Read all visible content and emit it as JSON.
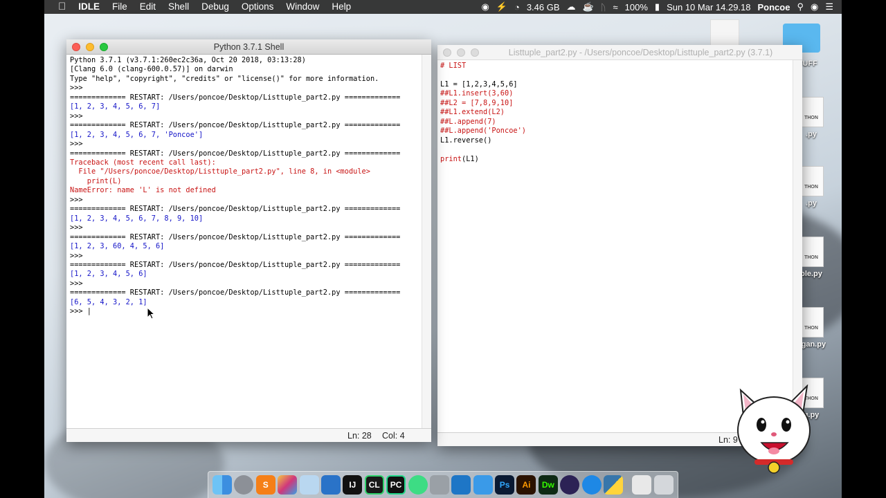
{
  "menubar": {
    "app": "IDLE",
    "items": [
      "File",
      "Edit",
      "Shell",
      "Debug",
      "Options",
      "Window",
      "Help"
    ],
    "memory": "3.46 GB",
    "battery": "100%",
    "datetime": "Sun 10 Mar  14.29.18",
    "user": "Poncoe"
  },
  "shell": {
    "title": "Python 3.7.1 Shell",
    "lines": [
      {
        "t": "Python 3.7.1 (v3.7.1:260ec2c36a, Oct 20 2018, 03:13:28)",
        "c": "blk"
      },
      {
        "t": "[Clang 6.0 (clang-600.0.57)] on darwin",
        "c": "blk"
      },
      {
        "t": "Type \"help\", \"copyright\", \"credits\" or \"license()\" for more information.",
        "c": "blk"
      },
      {
        "t": ">>>",
        "c": "blk"
      },
      {
        "t": "============= RESTART: /Users/poncoe/Desktop/Listtuple_part2.py =============",
        "c": "blk"
      },
      {
        "t": "[1, 2, 3, 4, 5, 6, 7]",
        "c": "blue"
      },
      {
        "t": ">>>",
        "c": "blk"
      },
      {
        "t": "============= RESTART: /Users/poncoe/Desktop/Listtuple_part2.py =============",
        "c": "blk"
      },
      {
        "t": "[1, 2, 3, 4, 5, 6, 7, 'Poncoe']",
        "c": "blue"
      },
      {
        "t": ">>>",
        "c": "blk"
      },
      {
        "t": "============= RESTART: /Users/poncoe/Desktop/Listtuple_part2.py =============",
        "c": "blk"
      },
      {
        "t": "Traceback (most recent call last):",
        "c": "red"
      },
      {
        "t": "  File \"/Users/poncoe/Desktop/Listtuple_part2.py\", line 8, in <module>",
        "c": "red"
      },
      {
        "t": "    print(L)",
        "c": "red"
      },
      {
        "t": "NameError: name 'L' is not defined",
        "c": "red"
      },
      {
        "t": ">>>",
        "c": "blk"
      },
      {
        "t": "============= RESTART: /Users/poncoe/Desktop/Listtuple_part2.py =============",
        "c": "blk"
      },
      {
        "t": "[1, 2, 3, 4, 5, 6, 7, 8, 9, 10]",
        "c": "blue"
      },
      {
        "t": ">>>",
        "c": "blk"
      },
      {
        "t": "============= RESTART: /Users/poncoe/Desktop/Listtuple_part2.py =============",
        "c": "blk"
      },
      {
        "t": "[1, 2, 3, 60, 4, 5, 6]",
        "c": "blue"
      },
      {
        "t": ">>>",
        "c": "blk"
      },
      {
        "t": "============= RESTART: /Users/poncoe/Desktop/Listtuple_part2.py =============",
        "c": "blk"
      },
      {
        "t": "[1, 2, 3, 4, 5, 6]",
        "c": "blue"
      },
      {
        "t": ">>>",
        "c": "blk"
      },
      {
        "t": "============= RESTART: /Users/poncoe/Desktop/Listtuple_part2.py =============",
        "c": "blk"
      },
      {
        "t": "[6, 5, 4, 3, 2, 1]",
        "c": "blue"
      },
      {
        "t": ">>> |",
        "c": "blk"
      }
    ],
    "status_ln": "Ln: 28",
    "status_col": "Col: 4"
  },
  "editor": {
    "title": "Listtuple_part2.py - /Users/poncoe/Desktop/Listtuple_part2.py (3.7.1)",
    "lines": [
      {
        "t": "# LIST",
        "c": "red"
      },
      {
        "t": "",
        "c": "blk"
      },
      {
        "t": "L1 = [1,2,3,4,5,6]",
        "c": "blk"
      },
      {
        "t": "##L1.insert(3,60)",
        "c": "red"
      },
      {
        "t": "##L2 = [7,8,9,10]",
        "c": "red"
      },
      {
        "t": "##L1.extend(L2)",
        "c": "red"
      },
      {
        "t": "##L.append(7)",
        "c": "red"
      },
      {
        "t": "##L.append('Poncoe')",
        "c": "red"
      },
      {
        "t": "L1.reverse()",
        "c": "blk"
      },
      {
        "t": "",
        "c": "blk"
      },
      {
        "t": "print(L1)",
        "c": "mixed"
      }
    ],
    "status_ln": "Ln: 9"
  },
  "desktop": {
    "items": [
      {
        "label": "P STUFF",
        "kind": "folder"
      },
      {
        "label": ".py",
        "kind": "file"
      },
      {
        "label": ".py",
        "kind": "file"
      },
      {
        "label": "ple.py",
        "kind": "file"
      },
      {
        "label": "ngan.py",
        "kind": "file"
      },
      {
        "label": "g.py",
        "kind": "file"
      }
    ]
  },
  "dock": {
    "apps": [
      "Finder",
      "Launchpad",
      "Sublime Text",
      "Final Cut",
      "Xcode Instruments",
      "Trello",
      "IntelliJ IDEA",
      "CLion",
      "PyCharm",
      "Android Studio",
      "Sequel",
      "Visual Studio Code",
      "Xcode",
      "Photoshop",
      "Illustrator",
      "Dreamweaver",
      "Eclipse",
      "Safari",
      "Python",
      "Documents",
      "Trash"
    ],
    "labels": [
      "",
      "",
      "S",
      "",
      "",
      "",
      "IJ",
      "CL",
      "PC",
      "",
      "",
      "",
      "",
      "Ps",
      "Ai",
      "Dw",
      "",
      "",
      "",
      "",
      ""
    ]
  },
  "colors": {
    "shell_output": "#1414c8",
    "error": "#c81414",
    "menubar": "#282828"
  }
}
